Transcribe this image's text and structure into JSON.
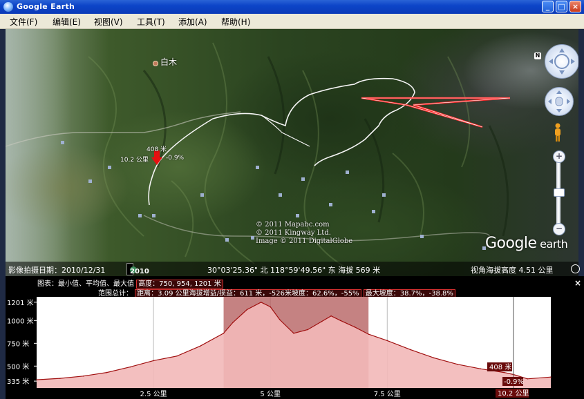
{
  "window": {
    "title": "Google Earth"
  },
  "menu": [
    "文件(F)",
    "编辑(E)",
    "视图(V)",
    "工具(T)",
    "添加(A)",
    "帮助(H)"
  ],
  "map": {
    "place_label": "白木",
    "marker_distance": "10.2 公里",
    "marker_elevation": "408 米",
    "marker_slope": "-0.9%",
    "copyright_lines": [
      "© 2011 Mapabc.com",
      "© 2011 Kingway Ltd.",
      "Image © 2011 DigitalGlobe"
    ],
    "logo": {
      "main": "Google",
      "suffix": " earth"
    },
    "compass_n": "N"
  },
  "status": {
    "image_date": "影像拍摄日期：2010/12/31",
    "year": "2010",
    "coordinates": "30°03'25.36\" 北 118°59'49.56\" 东  海拔  569 米",
    "eye_alt": "视角海拔高度    4.51 公里"
  },
  "profile": {
    "close": "×",
    "line1_prefix": "图表：最小值、平均值、最大值",
    "line1_box": "高度：750, 954, 1201 米",
    "line2_prefix": "范围总计：",
    "line2_box1": "距离：3.09 公里海拔增益/损益：611 米，-526米坡度：62.6%，-55%",
    "line2_box2": "最大坡度：38.7%，-38.8%",
    "marker_elev": "408 米",
    "marker_slope": "-0.9%",
    "marker_dist": "10.2 公里",
    "colors": {
      "fill": "#f2b8b8",
      "selection": "#b25858",
      "line": "#a01010"
    }
  },
  "chart_data": {
    "type": "area",
    "xlabel": "",
    "ylabel": "",
    "xlim": [
      0,
      11
    ],
    "ylim": [
      260,
      1260
    ],
    "ytick_labels": [
      "1201 米",
      "1000 米",
      "750 米",
      "500 米",
      "335 米"
    ],
    "yticks": [
      1201,
      1000,
      750,
      500,
      335
    ],
    "xtick_labels": [
      "2.5 公里",
      "5 公里",
      "7.5 公里"
    ],
    "xticks": [
      2.5,
      5,
      7.5
    ],
    "selection_range_km": [
      4.0,
      7.1
    ],
    "marker_km": 10.2,
    "x": [
      0,
      0.5,
      1,
      1.5,
      2,
      2.5,
      3,
      3.5,
      4,
      4.2,
      4.5,
      4.8,
      5.0,
      5.2,
      5.5,
      5.8,
      6.1,
      6.3,
      6.5,
      6.8,
      7.1,
      7.5,
      8,
      8.5,
      9,
      9.5,
      10,
      10.2,
      10.5,
      11
    ],
    "y": [
      350,
      365,
      390,
      430,
      490,
      560,
      610,
      720,
      860,
      980,
      1120,
      1201,
      1150,
      1010,
      860,
      900,
      990,
      1050,
      1000,
      930,
      850,
      780,
      680,
      590,
      520,
      470,
      430,
      408,
      360,
      380
    ]
  }
}
